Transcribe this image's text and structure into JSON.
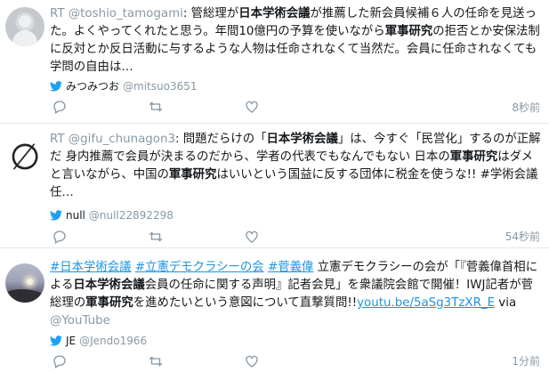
{
  "tweets": [
    {
      "prefix": "RT ",
      "rt_handle": "@toshio_tamogami",
      "sep": ": ",
      "segments": [
        {
          "t": "管総理が",
          "b": false
        },
        {
          "t": "日本学術会議",
          "b": true
        },
        {
          "t": "が推薦した新会員候補６人の任命を見送った。よくやってくれたと思う。年間10億円の予算を使いながら",
          "b": false
        },
        {
          "t": "軍事研究",
          "b": true
        },
        {
          "t": "の拒否とか安保法制に反対とか反日活動に与するような人物は任命されなくて当然だ。会員に任命されなくても学問の自由は…",
          "b": false
        }
      ],
      "user_name": "みつみつお",
      "user_handle": "@mitsuo3651",
      "time": "8秒前",
      "avatar": "default-profile-avatar"
    },
    {
      "prefix": "RT ",
      "rt_handle": "@gifu_chunagon3",
      "sep": ": ",
      "segments": [
        {
          "t": "問題だらけの「",
          "b": false
        },
        {
          "t": "日本学術会議",
          "b": true
        },
        {
          "t": "」は、今すぐ「民営化」するのが正解だ 身内推薦で会員が決まるのだから、学者の代表でもなんでもない 日本の",
          "b": false
        },
        {
          "t": "軍事研究",
          "b": true
        },
        {
          "t": "はダメと言いながら、中国の",
          "b": false
        },
        {
          "t": "軍事研究",
          "b": true
        },
        {
          "t": "はいいという国益に反する団体に税金を使うな!! #学術会議任…",
          "b": false
        }
      ],
      "avatar_glyph": "∅",
      "user_name": "null",
      "user_handle": "@null22892298",
      "time": "54秒前",
      "avatar": "null-symbol-avatar"
    },
    {
      "prefix": "",
      "rt_handle": "",
      "sep": "",
      "tags": [
        "#日本学術会議",
        "#立憲デモクラシーの会",
        "#菅義偉"
      ],
      "segments_a": [
        {
          "t": " 立憲デモクラシーの会が「『菅義偉首相による",
          "b": false
        },
        {
          "t": "日本学術会議",
          "b": true
        },
        {
          "t": "会員の任命に関する声明』記者会見」を衆議院会館で開催！IWJ記者が菅総理の",
          "b": false
        },
        {
          "t": "軍事研究",
          "b": true
        },
        {
          "t": "を進めたいという意図について直撃質問!!",
          "b": false
        }
      ],
      "link": "youtu.be/5aSg3TzXR_E",
      "via": " via ",
      "via_handle": "@YouTube",
      "user_name": "JE",
      "user_handle": "@Jendo1966",
      "time": "1分前",
      "avatar": "sunset-photo-avatar"
    }
  ],
  "colors": {
    "accent": "#1b95e0",
    "muted": "#8899a6",
    "divider": "#e1e8ed"
  },
  "icons": [
    "reply-icon",
    "retweet-icon",
    "like-icon",
    "twitter-bird-icon"
  ]
}
